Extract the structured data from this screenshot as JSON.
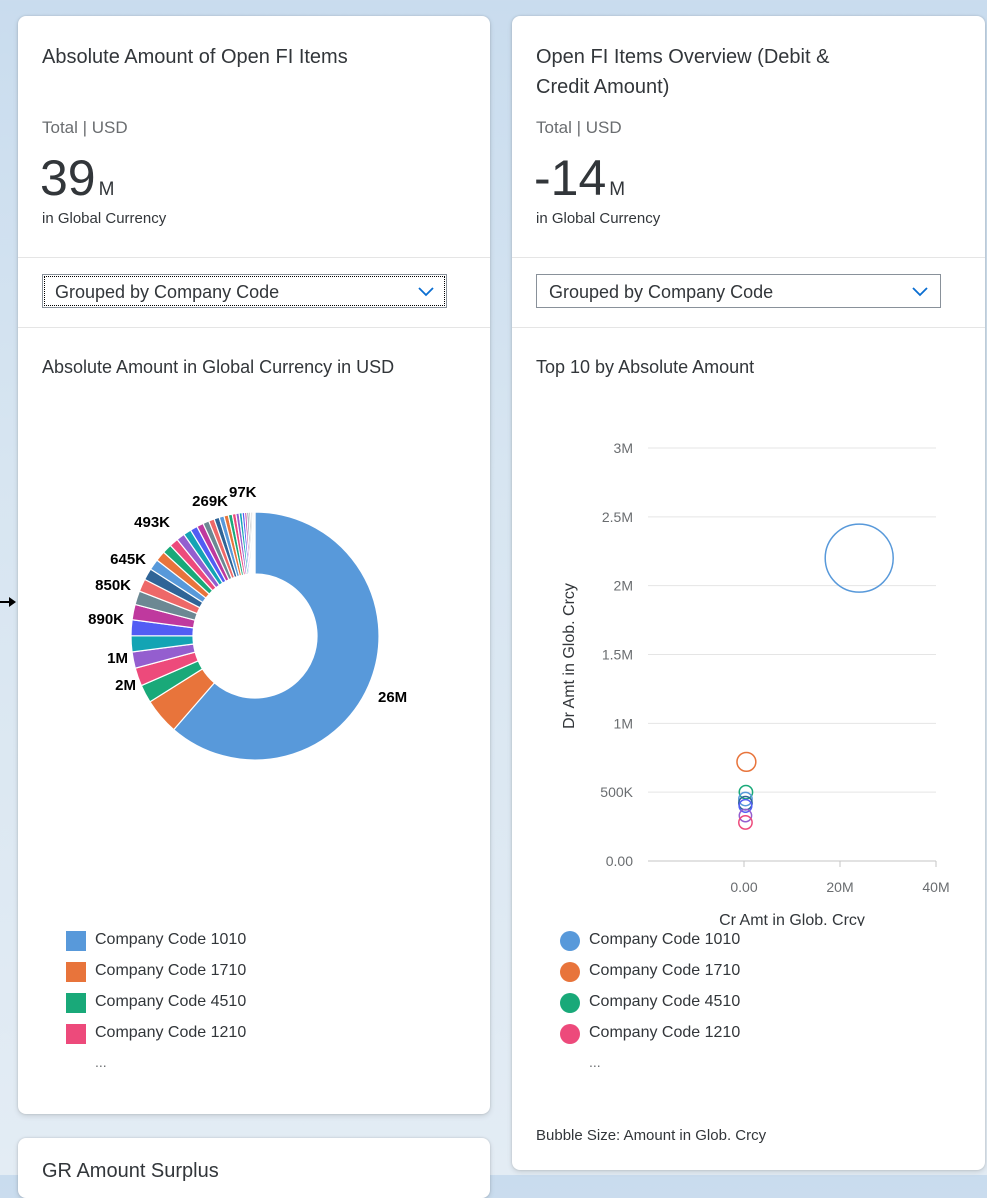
{
  "cards": {
    "left": {
      "title": "Absolute Amount of Open FI Items",
      "subtitle": "Total | USD",
      "kpi_value": "39",
      "kpi_unit": "M",
      "kpi_desc": "in Global Currency",
      "group_select": "Grouped by Company Code",
      "chart_title": "Absolute Amount in Global Currency in USD",
      "legend": [
        {
          "label": "Company Code 1010",
          "color": "#5899da"
        },
        {
          "label": "Company Code 1710",
          "color": "#e8743b"
        },
        {
          "label": "Company Code 4510",
          "color": "#19a979"
        },
        {
          "label": "Company Code 1210",
          "color": "#ed4a7b"
        }
      ],
      "legend_more": "..."
    },
    "right": {
      "title": "Open FI Items Overview (Debit & Credit Amount)",
      "subtitle": "Total | USD",
      "kpi_value": "-14",
      "kpi_unit": "M",
      "kpi_desc": "in Global Currency",
      "group_select": "Grouped by Company Code",
      "chart_title": "Top 10 by Absolute Amount",
      "legend": [
        {
          "label": "Company Code 1010",
          "color": "#5899da"
        },
        {
          "label": "Company Code 1710",
          "color": "#e8743b"
        },
        {
          "label": "Company Code 4510",
          "color": "#19a979"
        },
        {
          "label": "Company Code 1210",
          "color": "#ed4a7b"
        }
      ],
      "legend_more": "...",
      "bubble_note": "Bubble Size: Amount in Glob. Crcy"
    },
    "bottom": {
      "title": "GR Amount Surplus"
    }
  },
  "chart_data": [
    {
      "type": "pie",
      "title": "Absolute Amount in Global Currency in USD",
      "donut": true,
      "data_labels": [
        {
          "text": "26M",
          "value": 26000000,
          "color": "#5899da"
        },
        {
          "text": "2M",
          "value": 2000000,
          "color": "#e8743b"
        },
        {
          "text": "1M",
          "value": 1000000,
          "color": "#19a979"
        },
        {
          "text": "890K",
          "value": 890000,
          "color": "#945ecf"
        },
        {
          "text": "850K",
          "value": 850000,
          "color": "#2f6497"
        },
        {
          "text": "645K",
          "value": 645000,
          "color": "#ed4a7b"
        },
        {
          "text": "493K",
          "value": 493000,
          "color": "#6c8893"
        },
        {
          "text": "269K",
          "value": 269000,
          "color": "#2f6497"
        },
        {
          "text": "97K",
          "value": 97000,
          "color": "#9b9b9b"
        }
      ],
      "slices": [
        {
          "value": 26000000,
          "color": "#5899da"
        },
        {
          "value": 2000000,
          "color": "#e8743b"
        },
        {
          "value": 1000000,
          "color": "#19a979"
        },
        {
          "value": 1000000,
          "color": "#ed4a7b"
        },
        {
          "value": 900000,
          "color": "#945ecf"
        },
        {
          "value": 890000,
          "color": "#13a4b4"
        },
        {
          "value": 870000,
          "color": "#525df4"
        },
        {
          "value": 850000,
          "color": "#bf399e"
        },
        {
          "value": 760000,
          "color": "#6c8893"
        },
        {
          "value": 700000,
          "color": "#ee6868"
        },
        {
          "value": 645000,
          "color": "#2f6497"
        },
        {
          "value": 600000,
          "color": "#5899da"
        },
        {
          "value": 560000,
          "color": "#e8743b"
        },
        {
          "value": 520000,
          "color": "#19a979"
        },
        {
          "value": 493000,
          "color": "#ed4a7b"
        },
        {
          "value": 460000,
          "color": "#945ecf"
        },
        {
          "value": 430000,
          "color": "#13a4b4"
        },
        {
          "value": 400000,
          "color": "#525df4"
        },
        {
          "value": 370000,
          "color": "#bf399e"
        },
        {
          "value": 340000,
          "color": "#6c8893"
        },
        {
          "value": 310000,
          "color": "#ee6868"
        },
        {
          "value": 290000,
          "color": "#2f6497"
        },
        {
          "value": 269000,
          "color": "#5899da"
        },
        {
          "value": 240000,
          "color": "#e8743b"
        },
        {
          "value": 220000,
          "color": "#19a979"
        },
        {
          "value": 200000,
          "color": "#ed4a7b"
        },
        {
          "value": 180000,
          "color": "#945ecf"
        },
        {
          "value": 160000,
          "color": "#13a4b4"
        },
        {
          "value": 140000,
          "color": "#525df4"
        },
        {
          "value": 120000,
          "color": "#bf399e"
        },
        {
          "value": 110000,
          "color": "#6c8893"
        },
        {
          "value": 97000,
          "color": "#9b9b9b"
        },
        {
          "value": 90000,
          "color": "#b0b0b0"
        },
        {
          "value": 80000,
          "color": "#c4c4c4"
        },
        {
          "value": 70000,
          "color": "#d0d0d0"
        }
      ]
    },
    {
      "type": "scatter",
      "title": "Top 10 by Absolute Amount",
      "xlabel": "Cr Amt in Glob. Crcy",
      "ylabel": "Dr Amt in Glob. Crcy",
      "xlim": [
        -20000000,
        40000000
      ],
      "ylim": [
        0,
        3000000
      ],
      "x_ticks": [
        "0.00",
        "20M",
        "40M"
      ],
      "x_tick_values": [
        0,
        20000000,
        40000000
      ],
      "y_ticks": [
        "0.00",
        "500K",
        "1M",
        "1.5M",
        "2M",
        "2.5M",
        "3M"
      ],
      "y_tick_values": [
        0,
        500000,
        1000000,
        1500000,
        2000000,
        2500000,
        3000000
      ],
      "grid": true,
      "points": [
        {
          "x": 24000000,
          "y": 2200000,
          "size": 26000000,
          "color": "#5899da"
        },
        {
          "x": 500000,
          "y": 720000,
          "size": 2000000,
          "color": "#e8743b"
        },
        {
          "x": 400000,
          "y": 500000,
          "size": 1000000,
          "color": "#19a979"
        },
        {
          "x": 300000,
          "y": 450000,
          "size": 1000000,
          "color": "#5899da"
        },
        {
          "x": 300000,
          "y": 420000,
          "size": 1000000,
          "color": "#2f6497"
        },
        {
          "x": 300000,
          "y": 400000,
          "size": 900000,
          "color": "#525df4"
        },
        {
          "x": 300000,
          "y": 330000,
          "size": 850000,
          "color": "#945ecf"
        },
        {
          "x": 300000,
          "y": 280000,
          "size": 1000000,
          "color": "#ed4a7b"
        }
      ]
    }
  ]
}
